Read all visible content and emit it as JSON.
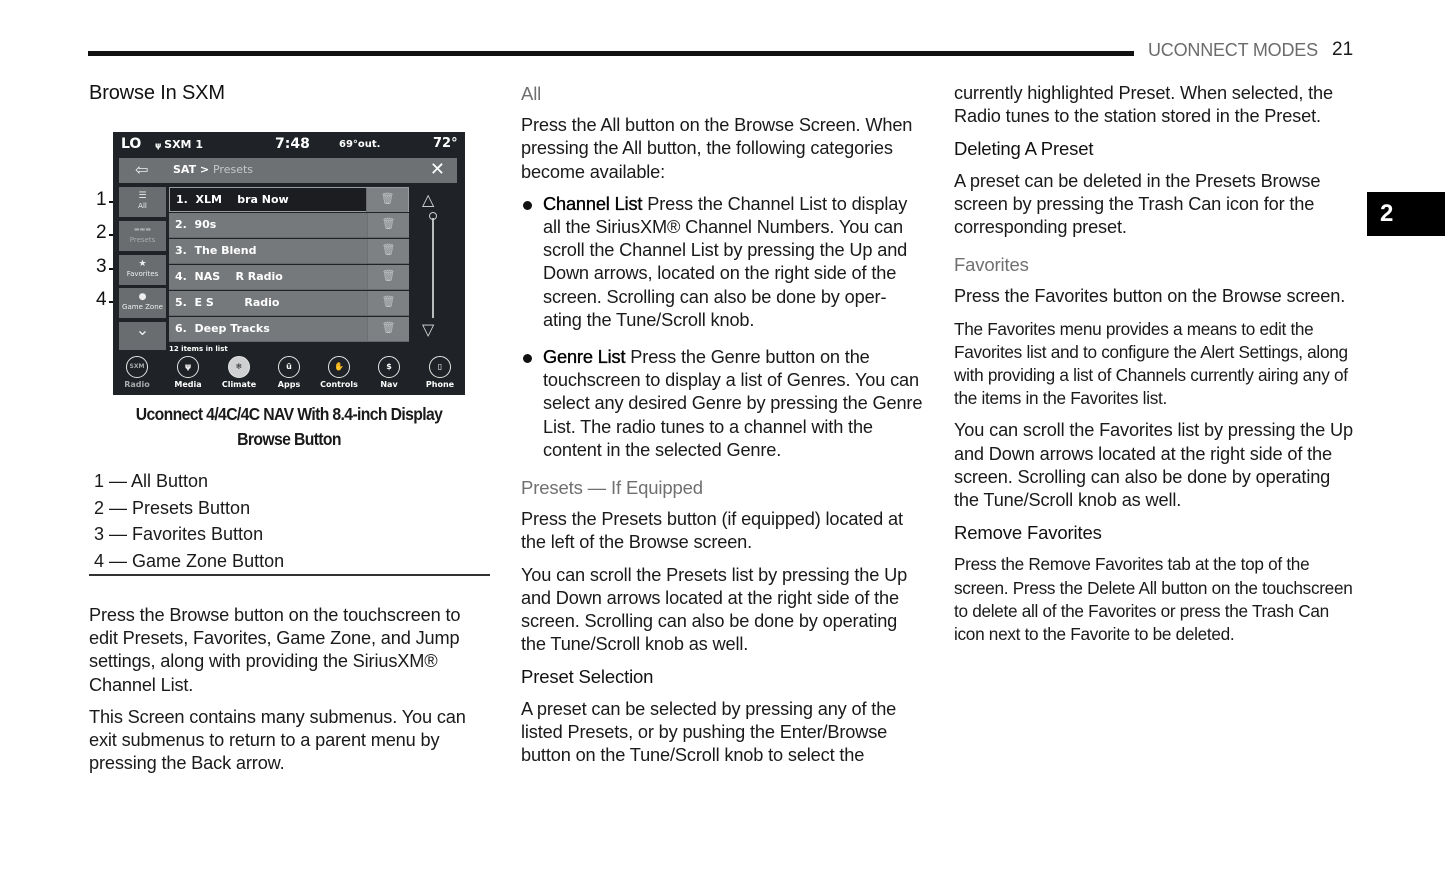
{
  "header": {
    "section_title": "UCONNECT MODES",
    "page_number": "21",
    "chapter_tab": "2"
  },
  "column1": {
    "heading": "Browse In SXM",
    "figure": {
      "callouts": [
        "1",
        "2",
        "3",
        "4"
      ],
      "screen": {
        "status_bar": {
          "left_temp": "LO",
          "source": "SXM 1",
          "source_icon": "signal-icon",
          "time": "7:48",
          "outside_temp": "69°out.",
          "right_temp": "72°"
        },
        "nav_bar": {
          "back_icon": "back-arrow-icon",
          "breadcrumb_main": "SAT > ",
          "breadcrumb_sub": "Presets",
          "close_icon": "close-icon"
        },
        "side_buttons": [
          {
            "label": "All",
            "icon": "list-icon",
            "glyph": "☰"
          },
          {
            "label": "Presets",
            "icon": "presets-icon",
            "glyph": "▬▬▬"
          },
          {
            "label": "Favorites",
            "icon": "star-icon",
            "glyph": "★"
          },
          {
            "label": "Game Zone",
            "icon": "ball-icon",
            "glyph": "●"
          },
          {
            "label": "",
            "icon": "chevron-down-icon",
            "glyph": "⌄"
          }
        ],
        "presets": [
          {
            "label": "1.  XLM    bra Now",
            "selected": true
          },
          {
            "label": "2.  90s",
            "selected": false
          },
          {
            "label": "3.  The Blend",
            "selected": false
          },
          {
            "label": "4.  NAS    R Radio",
            "selected": false
          },
          {
            "label": "5.  E S        Radio",
            "selected": false
          },
          {
            "label": "6.  Deep Tracks",
            "selected": false
          }
        ],
        "trash_glyph": "🗑",
        "scroll_up_glyph": "△",
        "scroll_down_glyph": "▽",
        "list_count": "12 items in list",
        "dock": [
          {
            "label": "Radio",
            "icon": "sxm-icon",
            "glyph": "SXM",
            "state": "dim"
          },
          {
            "label": "Media",
            "icon": "usb-icon",
            "glyph": "ψ",
            "state": "normal"
          },
          {
            "label": "Climate",
            "icon": "climate-icon",
            "glyph": "❄",
            "state": "active"
          },
          {
            "label": "Apps",
            "icon": "apps-icon",
            "glyph": "ū",
            "state": "normal"
          },
          {
            "label": "Controls",
            "icon": "controls-icon",
            "glyph": "✋",
            "state": "normal"
          },
          {
            "label": "Nav",
            "icon": "nav-icon",
            "glyph": "$",
            "state": "normal"
          },
          {
            "label": "Phone",
            "icon": "phone-icon",
            "glyph": "▯",
            "state": "normal"
          }
        ]
      },
      "caption": "Uconnect 4/4C/4C NAV With 8.4-inch Display Browse Button"
    },
    "legend": [
      "1 — All Button",
      "2 — Presets Button",
      "3 — Favorites Button",
      "4 — Game Zone Button"
    ],
    "paragraphs": [
      "Press the Browse button on the touchscreen to edit Presets, Favorites, Game Zone, and Jump settings, along with providing the SiriusXM® Channel List.",
      "This Screen contains many submenus. You can exit submenus to return to a parent menu by pressing the Back arrow."
    ]
  },
  "column2": {
    "all_heading": "All",
    "all_intro": "Press the All button on the Browse Screen. When pressing the All button, the following categories become available:",
    "bullets": [
      {
        "term": "Channel List",
        "text": " Press the Channel List to display all the SiriusXM® Channel Numbers. You can scroll the Channel List by pressing the Up and Down arrows, located on the right side of the screen. Scrolling can also be done by oper-ating the Tune/Scroll knob."
      },
      {
        "term": "Genre List",
        "text": " Press the Genre button on the touchscreen to display a list of Genres. You can select any desired Genre by pressing the Genre List. The radio tunes to a channel with the content in the selected Genre."
      }
    ],
    "presets_heading": "Presets — If Equipped",
    "presets_p1": "Press the Presets button (if equipped) located at the left of the Browse screen.",
    "presets_p2": "You can scroll the Presets list by pressing the Up and Down arrows located at the right side of the screen. Scrolling can also be done by operating the Tune/Scroll knob as well.",
    "selection_heading": "Preset Selection",
    "selection_p": "A preset can be selected by pressing any of the listed Presets, or by pushing the Enter/Browse button on the Tune/Scroll knob to select the"
  },
  "column3": {
    "continued_p": "currently highlighted Preset. When selected, the Radio tunes to the station stored in the Preset.",
    "deleting_heading": "Deleting A Preset",
    "deleting_p": "A preset can be deleted in the Presets Browse screen by pressing the Trash Can icon for the corresponding preset.",
    "favorites_heading": "Favorites",
    "favorites_p1": "Press the Favorites button on the Browse screen.",
    "favorites_p2": "The Favorites menu provides a means to edit the Favorites list and to configure the Alert Settings, along with providing a list of Channels currently airing any of the items in the Favorites list.",
    "favorites_p3": "You can scroll the Favorites list by pressing the Up and Down arrows located at the right side of the screen. Scrolling can also be done by operating the Tune/Scroll knob as well.",
    "remove_heading": "Remove Favorites",
    "remove_p": "Press the Remove Favorites tab at the top of the screen. Press the Delete All button on the touchscreen to delete all of the Favorites or press the Trash Can icon next to the Favorite to be deleted."
  }
}
